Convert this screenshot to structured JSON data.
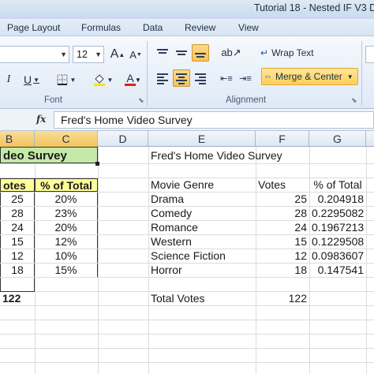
{
  "window": {
    "title": "Tutorial 18 - Nested IF V3 D"
  },
  "ribbon_tabs": [
    "Page Layout",
    "Formulas",
    "Data",
    "Review",
    "View"
  ],
  "font_group": {
    "font_size": "12",
    "grow_label": "A",
    "shrink_label": "A",
    "italic_label": "I",
    "underline_label": "U",
    "font_color_label": "A",
    "group_label": "Font"
  },
  "alignment_group": {
    "wrap_text_label": "Wrap Text",
    "merge_center_label": "Merge & Center",
    "group_label": "Alignment"
  },
  "formula_bar": {
    "fx_label": "fx",
    "content": "Fred's Home Video Survey"
  },
  "columns": [
    "B",
    "C",
    "D",
    "E",
    "F",
    "G"
  ],
  "left_table": {
    "title": "deo Survey",
    "headers": [
      "otes",
      "% of Total"
    ],
    "rows": [
      [
        "25",
        "20%"
      ],
      [
        "28",
        "23%"
      ],
      [
        "24",
        "20%"
      ],
      [
        "15",
        "12%"
      ],
      [
        "12",
        "10%"
      ],
      [
        "18",
        "15%"
      ]
    ],
    "total": "122"
  },
  "right_table": {
    "title": "Fred's Home Video Survey",
    "headers": [
      "Movie Genre",
      "Votes",
      "% of Total"
    ],
    "rows": [
      [
        "Drama",
        "25",
        "0.204918"
      ],
      [
        "Comedy",
        "28",
        "0.2295082"
      ],
      [
        "Romance",
        "24",
        "0.1967213"
      ],
      [
        "Western",
        "15",
        "0.1229508"
      ],
      [
        "Science Fiction",
        "12",
        "0.0983607"
      ],
      [
        "Horror",
        "18",
        "0.147541"
      ]
    ],
    "total_label": "Total Votes",
    "total_value": "122"
  },
  "colors": {
    "header_fill": "#ffff99",
    "title_fill": "#c4e9a8",
    "selection_fill": "#f2c35a",
    "ribbon_bg": "#dfe9f6"
  }
}
